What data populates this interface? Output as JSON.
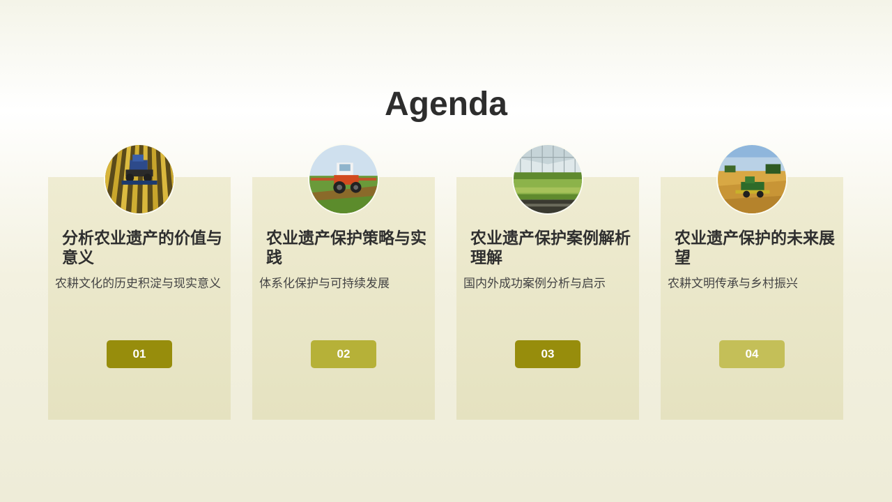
{
  "slide": {
    "title": "Agenda"
  },
  "items": [
    {
      "title": "分析农业遗产的价值与意义",
      "description": "农耕文化的历史积淀与现实意义",
      "number": "01",
      "badge_color": "#978d0c",
      "image": "tractor-in-crop-rows-photo"
    },
    {
      "title": "农业遗产保护策略与实践",
      "description": "体系化保护与可持续发展",
      "number": "02",
      "badge_color": "#b6b138",
      "image": "tractor-spraying-field-photo"
    },
    {
      "title": "农业遗产保护案例解析理解",
      "description": "国内外成功案例分析与启示",
      "number": "03",
      "badge_color": "#978d0c",
      "image": "greenhouse-crops-photo"
    },
    {
      "title": "农业遗产保护的未来展望",
      "description": "农耕文明传承与乡村振兴",
      "number": "04",
      "badge_color": "#c4bf58",
      "image": "combine-harvester-wheat-photo"
    }
  ]
}
